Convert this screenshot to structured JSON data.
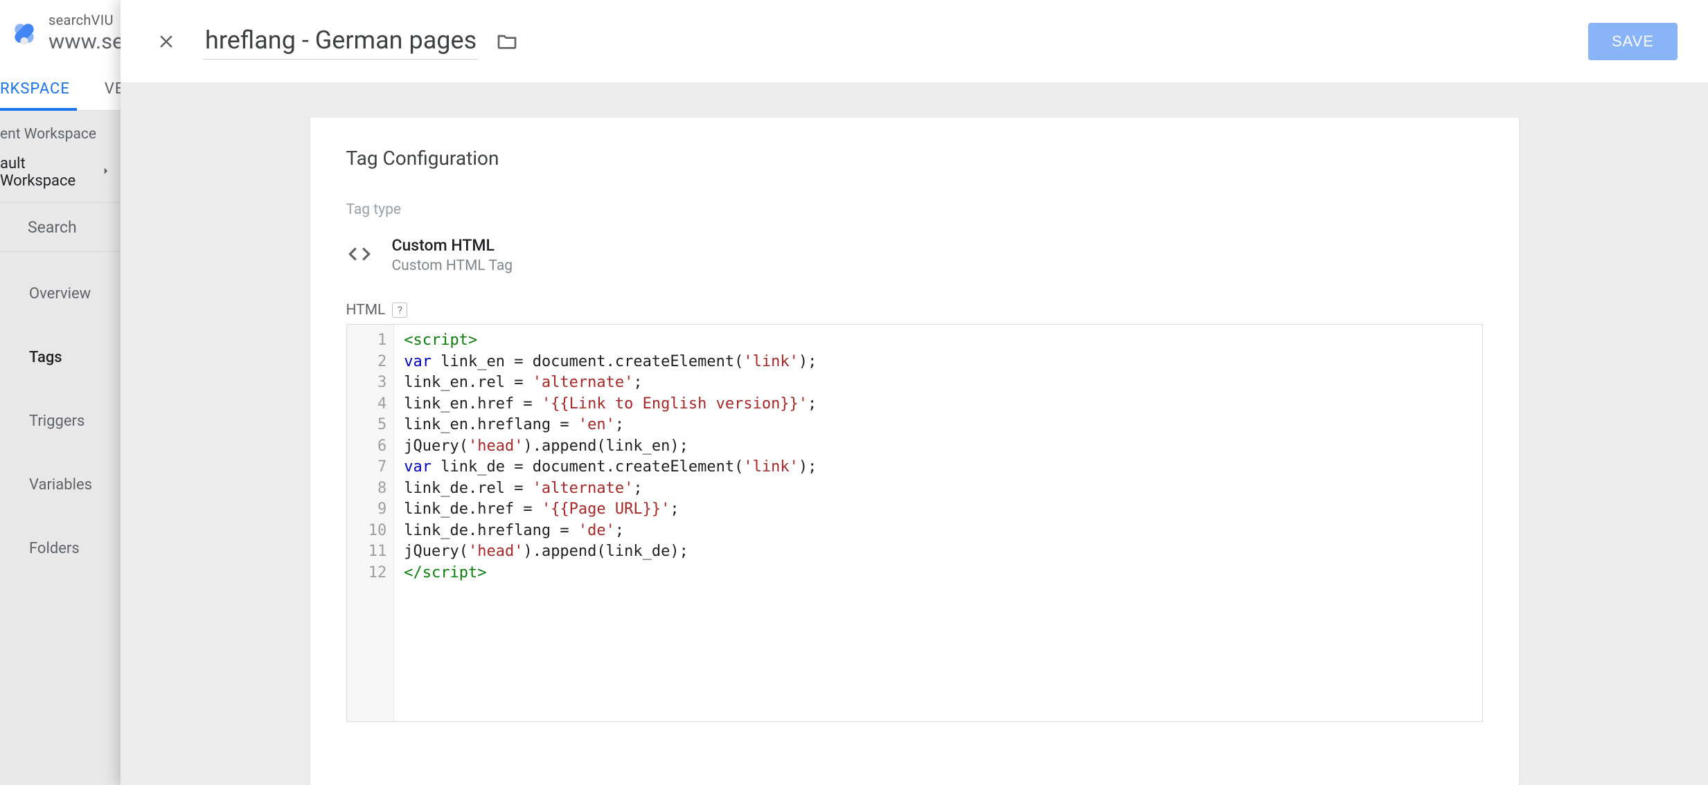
{
  "bg": {
    "subtitle": "searchVIU",
    "title": "www.sear",
    "tab_workspace": "RKSPACE",
    "tab_versions": "VERS",
    "ws_section_label": "ent Workspace",
    "ws_current": "ault Workspace",
    "search_placeholder": "Search",
    "nav": {
      "overview": "Overview",
      "tags": "Tags",
      "triggers": "Triggers",
      "variables": "Variables",
      "folders": "Folders"
    }
  },
  "overlay": {
    "title": "hreflang - German pages",
    "save_label": "SAVE"
  },
  "card": {
    "heading": "Tag Configuration",
    "tagtype_label": "Tag type",
    "tagtype_name": "Custom HTML",
    "tagtype_sub": "Custom HTML Tag",
    "html_label": "HTML",
    "help": "?"
  },
  "code": {
    "line_numbers": "  1\n  2\n  3\n  4\n  5\n  6\n  7\n  8\n  9\n 10\n 11\n 12",
    "l1_a": "<script>",
    "l2_a": "var",
    "l2_b": " link_en = document.createElement(",
    "l2_c": "'link'",
    "l2_d": ");",
    "l3_a": "link_en.rel = ",
    "l3_b": "'alternate'",
    "l3_c": ";",
    "l4_a": "link_en.href = ",
    "l4_b": "'{{Link to English version}}'",
    "l4_c": ";",
    "l5_a": "link_en.hreflang = ",
    "l5_b": "'en'",
    "l5_c": ";",
    "l6_a": "jQuery(",
    "l6_b": "'head'",
    "l6_c": ").append(link_en);",
    "l7_a": "var",
    "l7_b": " link_de = document.createElement(",
    "l7_c": "'link'",
    "l7_d": ");",
    "l8_a": "link_de.rel = ",
    "l8_b": "'alternate'",
    "l8_c": ";",
    "l9_a": "link_de.href = ",
    "l9_b": "'{{Page URL}}'",
    "l9_c": ";",
    "l10_a": "link_de.hreflang = ",
    "l10_b": "'de'",
    "l10_c": ";",
    "l11_a": "jQuery(",
    "l11_b": "'head'",
    "l11_c": ").append(link_de);",
    "l12_a": "</script>"
  }
}
